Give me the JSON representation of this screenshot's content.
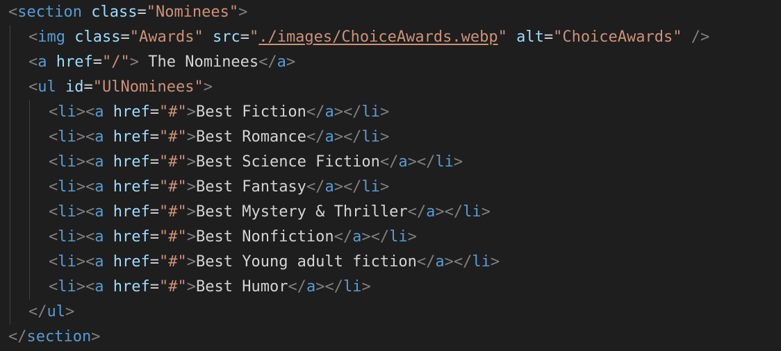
{
  "colors": {
    "background": "#1e1e1e",
    "punctuation": "#808080",
    "tag": "#569cd6",
    "attribute": "#9cdcfe",
    "string": "#ce9178",
    "text": "#d4d4d4"
  },
  "code": {
    "section_open": {
      "tag": "section",
      "attr": "class",
      "value": "\"Nominees\""
    },
    "img": {
      "tag": "img",
      "class_attr": "class",
      "class_value": "\"Awards\"",
      "src_attr": "src",
      "src_quote_open": "\"",
      "src_value": "./images/ChoiceAwards.webp",
      "src_quote_close": "\"",
      "alt_attr": "alt",
      "alt_value": "\"ChoiceAwards\""
    },
    "anchor": {
      "tag": "a",
      "attr": "href",
      "value": "\"/\"",
      "text": " The Nominees"
    },
    "ul_open": {
      "tag": "ul",
      "attr": "id",
      "value": "\"UlNominees\""
    },
    "list_items": [
      {
        "text": "Best Fiction"
      },
      {
        "text": "Best Romance"
      },
      {
        "text": "Best Science Fiction"
      },
      {
        "text": "Best Fantasy"
      },
      {
        "text": "Best Mystery & Thriller"
      },
      {
        "text": "Best Nonfiction"
      },
      {
        "text": "Best Young adult fiction"
      },
      {
        "text": "Best Humor"
      }
    ],
    "li_tag": "li",
    "a_tag": "a",
    "li_href_attr": "href",
    "li_href_value": "\"#\"",
    "ul_close": "ul",
    "section_close": "section"
  }
}
